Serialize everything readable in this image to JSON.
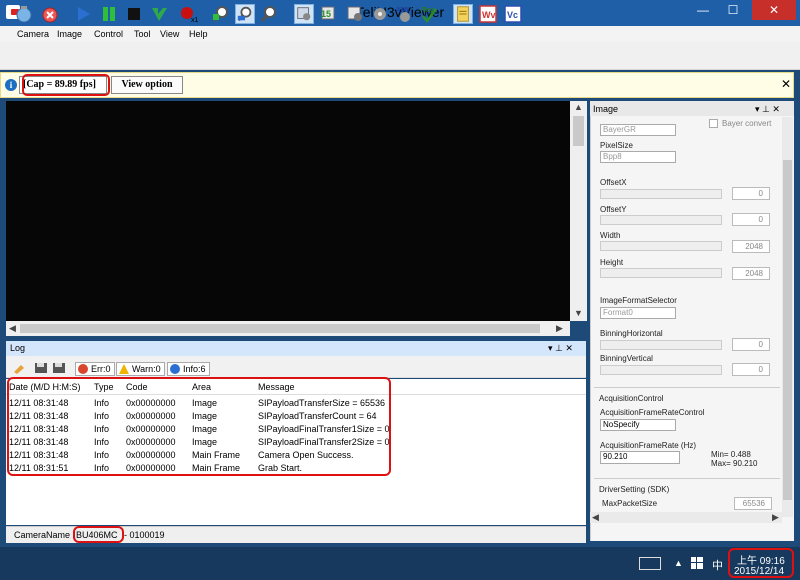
{
  "window": {
    "title": "TeliU3vViewer",
    "controls": {
      "minimize": "—",
      "maximize": "☐",
      "close": "✕"
    }
  },
  "menu": [
    "Camera",
    "Image",
    "Control",
    "Tool",
    "View",
    "Help"
  ],
  "toolbar": {
    "icons": [
      "camera-open-icon",
      "camera-close-icon",
      "play-icon",
      "pause-icon",
      "stop-icon",
      "trigger-icon",
      "record-icon",
      "zoom-in-icon",
      "zoom-fit-icon",
      "zoom-out-icon",
      "settings-icon",
      "settings-icon-2",
      "settings-icon-3",
      "settings-icon-4",
      "xml-icon",
      "register-icon",
      "doc-icon",
      "wv-icon",
      "vc-icon"
    ],
    "xml_label": "XML",
    "reg_label": "Reg",
    "wv_label": "Wv",
    "vc_label": "Vc"
  },
  "info_strip": {
    "fps": "[Cap = 89.89 fps]",
    "view_option": "View option",
    "close": "✕"
  },
  "log": {
    "title": "Log",
    "pin": "▾ ⊥ ✕",
    "err": "Err:0",
    "warn": "Warn:0",
    "info": "Info:6",
    "columns": [
      "Date (M/D H:M:S)",
      "Type",
      "Code",
      "Area",
      "Message"
    ],
    "rows": [
      [
        "12/11 08:31:48",
        "Info",
        "0x00000000",
        "Image",
        "SIPayloadTransferSize = 65536"
      ],
      [
        "12/11 08:31:48",
        "Info",
        "0x00000000",
        "Image",
        "SIPayloadTransferCount = 64"
      ],
      [
        "12/11 08:31:48",
        "Info",
        "0x00000000",
        "Image",
        "SIPayloadFinalTransfer1Size = 0"
      ],
      [
        "12/11 08:31:48",
        "Info",
        "0x00000000",
        "Image",
        "SIPayloadFinalTransfer2Size = 0"
      ],
      [
        "12/11 08:31:48",
        "Info",
        "0x00000000",
        "Main Frame",
        "Camera Open Success."
      ],
      [
        "12/11 08:31:51",
        "Info",
        "0x00000000",
        "Main Frame",
        "Grab Start."
      ]
    ]
  },
  "statusbar": {
    "label": "CameraName :",
    "model": "BU406MC",
    "serial": "- 0100019"
  },
  "image_panel": {
    "title": "Image",
    "header_controls": "▾ ⊥ ✕",
    "pixel_color_filter": "BayerGR",
    "bayer_convert": "Bayer convert",
    "pixel_size_label": "PixelSize",
    "pixel_size": "Bpp8",
    "offset_x_label": "OffsetX",
    "offset_x": "0",
    "offset_y_label": "OffsetY",
    "offset_y": "0",
    "width_label": "Width",
    "width": "2048",
    "height_label": "Height",
    "height": "2048",
    "image_format_label": "ImageFormatSelector",
    "image_format": "Format0",
    "binning_h_label": "BinningHorizontal",
    "binning_h": "0",
    "binning_v_label": "BinningVertical",
    "binning_v": "0",
    "acq_group": "AcquisitionControl",
    "acq_rate_ctrl_label": "AcquisitionFrameRateControl",
    "acq_rate_ctrl": "NoSpecify",
    "acq_rate_label": "AcquisitionFrameRate (Hz)",
    "acq_rate": "90.210",
    "acq_min": "Min= 0.488",
    "acq_max": "Max= 90.210",
    "driver_group": "DriverSetting (SDK)",
    "max_packet_label": "MaxPacketSize",
    "max_packet": "65536"
  },
  "taskbar": {
    "ime": "中",
    "time": "上午 09:16",
    "date": "2015/12/14"
  }
}
